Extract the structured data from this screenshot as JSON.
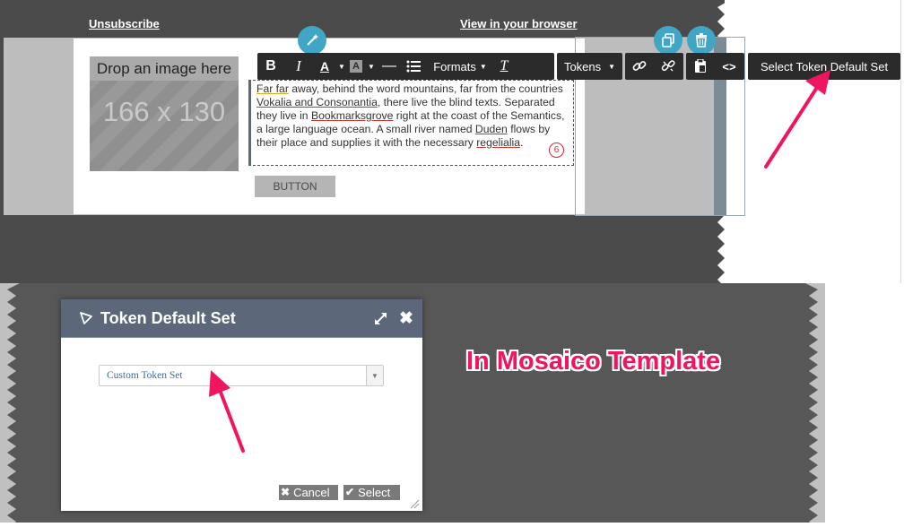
{
  "top": {
    "unsubscribe_link": "Unsubscribe",
    "view_browser_link": "View in your browser"
  },
  "image_block": {
    "caption": "Drop an image here",
    "size": "166 x 130"
  },
  "text_block": {
    "pre1": "Far far",
    "s1": " away, behind the word mountains, far from the countries ",
    "u1": "Vokalia and Consonantia",
    "s2": ", there live the blind texts. Separated they live in ",
    "u2": "Bookmarksgrove",
    "s3": " right at the coast of the Semantics, a large language ocean. A small river named ",
    "u3": "Duden",
    "s4": " flows by their place and supplies it with the necessary ",
    "u4": "regelialia",
    "s5": ".",
    "counter": "6"
  },
  "email_button_label": "BUTTON",
  "toolbar": {
    "formats_label": "Formats",
    "tokens_label": "Tokens",
    "select_token_label": "Select Token Default Set"
  },
  "dialog": {
    "title": "Token Default Set",
    "dropdown_value": "Custom Token Set",
    "cancel_label": "Cancel",
    "select_label": "Select"
  },
  "annotation": "In Mosaico Template",
  "colors": {
    "accent": "#41a6c6",
    "annotation": "#f0155f",
    "toolbar_bg": "#2b2b2b",
    "dialog_header": "#5c6879"
  }
}
